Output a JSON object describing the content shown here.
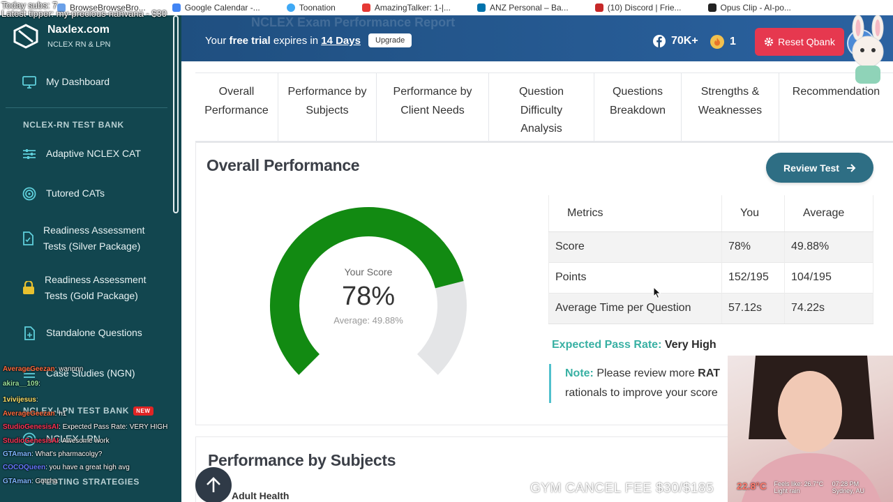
{
  "browser": {
    "bookmarks": [
      {
        "label": "BrowseBrowseBro...",
        "color": "#6aa0e8"
      },
      {
        "label": "Google Calendar -...",
        "color": "#4285f4"
      },
      {
        "label": "Toonation",
        "color": "#3fa9f5"
      },
      {
        "label": "AmazingTalker: 1-|...",
        "color": "#e53935"
      },
      {
        "label": "ANZ Personal – Ba...",
        "color": "#0072ac"
      },
      {
        "label": "(10) Discord | Frie...",
        "color": "#c62828"
      },
      {
        "label": "Opus Clip - AI-po...",
        "color": "#222222"
      }
    ]
  },
  "sidebar": {
    "brand_name": "Naxlex.com",
    "brand_sub": "NCLEX RN & LPN",
    "dashboard": "My Dashboard",
    "section_rn": "NCLEX-RN TEST BANK",
    "items": [
      {
        "label": "Adaptive NCLEX CAT",
        "icon": "sliders-icon"
      },
      {
        "label": "Tutored CATs",
        "icon": "target-icon"
      },
      {
        "label": "Readiness Assessment Tests (Silver Package)",
        "icon": "document-icon"
      },
      {
        "label": "Readiness Assessment Tests (Gold Package)",
        "icon": "lock-icon"
      },
      {
        "label": "Standalone Questions",
        "icon": "file-plus-icon"
      },
      {
        "label": "Case Studies (NGN)",
        "icon": "list-icon"
      }
    ],
    "section_lpn": "NCLEX-LPN TEST BANK",
    "new_badge": "NEW",
    "lpn_item": "NCLEX LPN",
    "strategies": "TESTING STRATEGIES"
  },
  "topbar": {
    "ghost_title": "NCLEX Exam Performance Report",
    "trial_prefix": "Your",
    "trial_bold": "free trial",
    "trial_mid": "expires in",
    "trial_days": "14 Days",
    "upgrade": "Upgrade",
    "facebook_count": "70K+",
    "streak_count": "1",
    "reset": "Reset Qbank"
  },
  "tabs": [
    "Overall Performance",
    "Performance by Subjects",
    "Performance by Client Needs",
    "Question Difficulty Analysis",
    "Questions Breakdown",
    "Strengths & Weaknesses",
    "Recommendation"
  ],
  "overall": {
    "title": "Overall Performance",
    "review_button": "Review Test",
    "gauge": {
      "label": "Your Score",
      "value_text": "78%",
      "score": 78,
      "average_text": "Average: 49.88%",
      "fill_color": "#128a12",
      "track_color": "#e4e5e7"
    },
    "table": {
      "headers": [
        "Metrics",
        "You",
        "Average"
      ],
      "rows": [
        [
          "Score",
          "78%",
          "49.88%"
        ],
        [
          "Points",
          "152/195",
          "104/195"
        ],
        [
          "Average Time per Question",
          "57.12s",
          "74.22s"
        ]
      ]
    },
    "pass_label": "Expected Pass Rate:",
    "pass_value": "Very High",
    "note_label": "Note:",
    "note_text": "Please review more",
    "note_bold": "RAT",
    "note_text2": "rationals to improve your score"
  },
  "subjects": {
    "title": "Performance by Subjects",
    "first_subject": "Adult Health"
  },
  "stream": {
    "subs": "Today subs: 7",
    "tipper": "Latest tipper: my-precious-nahvana - $30",
    "chat": [
      {
        "user": "AverageGeezan",
        "msg": ": wannnn",
        "color": "#ff6a3d"
      },
      {
        "user": "akira__109",
        "msg": ":",
        "color": "#9be29b"
      },
      {
        "user": "1vivijesus",
        "msg": ":",
        "color": "#ffe066"
      },
      {
        "user": "AverageGeezan",
        "msg": ": h1",
        "color": "#ff6a3d"
      },
      {
        "user": "StudioGenesisAI",
        "msg": ": Expected Pass Rate: VERY HIGH",
        "color": "#ff3355"
      },
      {
        "user": "StudioGenesisAI",
        "msg": ": Awesome work",
        "color": "#ff3355"
      },
      {
        "user": "GTAman",
        "msg": ": What's pharmacolgy?",
        "color": "#7fb6ff"
      },
      {
        "user": "COCOQueen",
        "msg": ": you have a great high avg",
        "color": "#6677ff"
      },
      {
        "user": "GTAman",
        "msg": ": Gotcha",
        "color": "#7fb6ff"
      }
    ],
    "gym": "GYM CANCEL FEE $30/$185",
    "weather_temp": "22.8°C",
    "weather_feels": "Feels like: 26.7°C",
    "weather_desc": "Light rain",
    "time": "07:28 PM",
    "city": "Sydney, AU"
  }
}
